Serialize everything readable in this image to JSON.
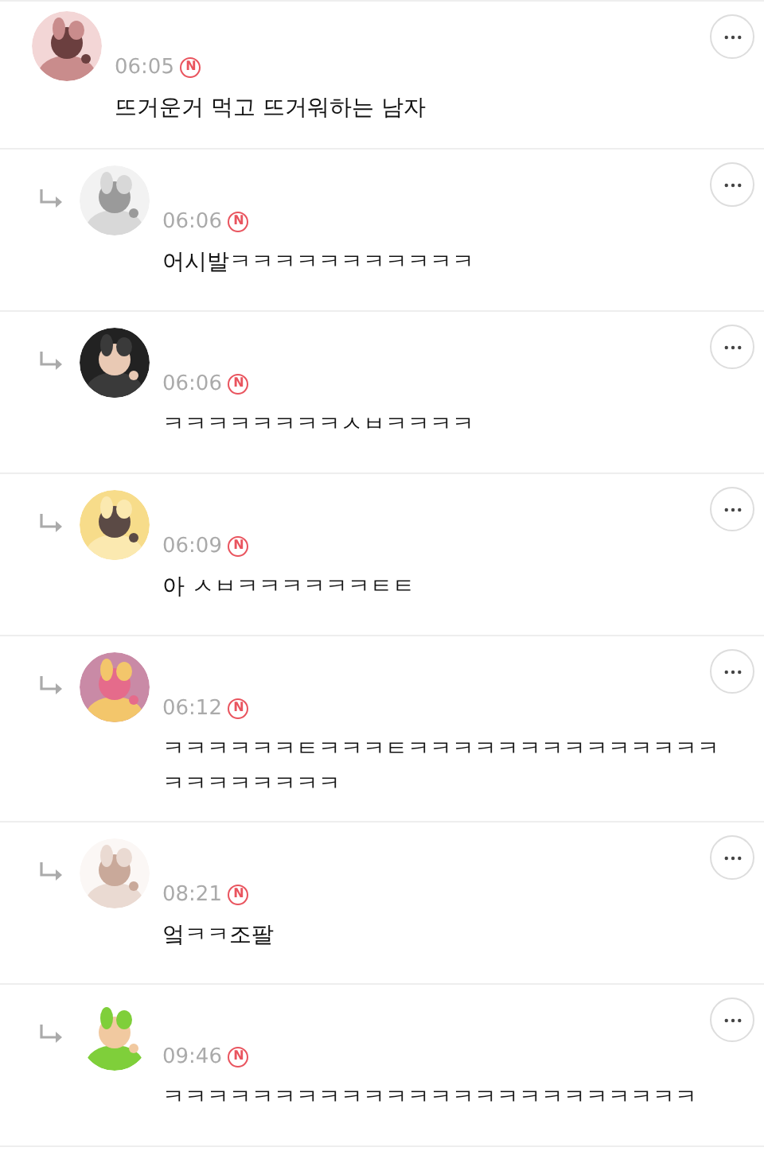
{
  "comments": [
    {
      "reply": false,
      "time": "06:05",
      "badge": "N",
      "text": "뜨거운거 먹고 뜨거워하는 남자"
    },
    {
      "reply": true,
      "time": "06:06",
      "badge": "N",
      "text": "어시발ㅋㅋㅋㅋㅋㅋㅋㅋㅋㅋㅋ"
    },
    {
      "reply": true,
      "time": "06:06",
      "badge": "N",
      "text": "ㅋㅋㅋㅋㅋㅋㅋㅋㅅㅂㅋㅋㅋㅋ"
    },
    {
      "reply": true,
      "time": "06:09",
      "badge": "N",
      "text": "아 ㅅㅂㅋㅋㅋㅋㅋㅋㅌㅌ"
    },
    {
      "reply": true,
      "time": "06:12",
      "badge": "N",
      "text": "ㅋㅋㅋㅋㅋㅋㅌㅋㅋㅋㅌㅋㅋㅋㅋㅋㅋㅋㅋㅋㅋㅋㅋㅋㅋㅋㅋㅋㅋㅋㅋㅋㅋ"
    },
    {
      "reply": true,
      "time": "08:21",
      "badge": "N",
      "text": "엌ㅋㅋ조팔"
    },
    {
      "reply": true,
      "time": "09:46",
      "badge": "N",
      "text": "ㅋㅋㅋㅋㅋㅋㅋㅋㅋㅋㅋㅋㅋㅋㅋㅋㅋㅋㅋㅋㅋㅋㅋㅋ"
    }
  ]
}
